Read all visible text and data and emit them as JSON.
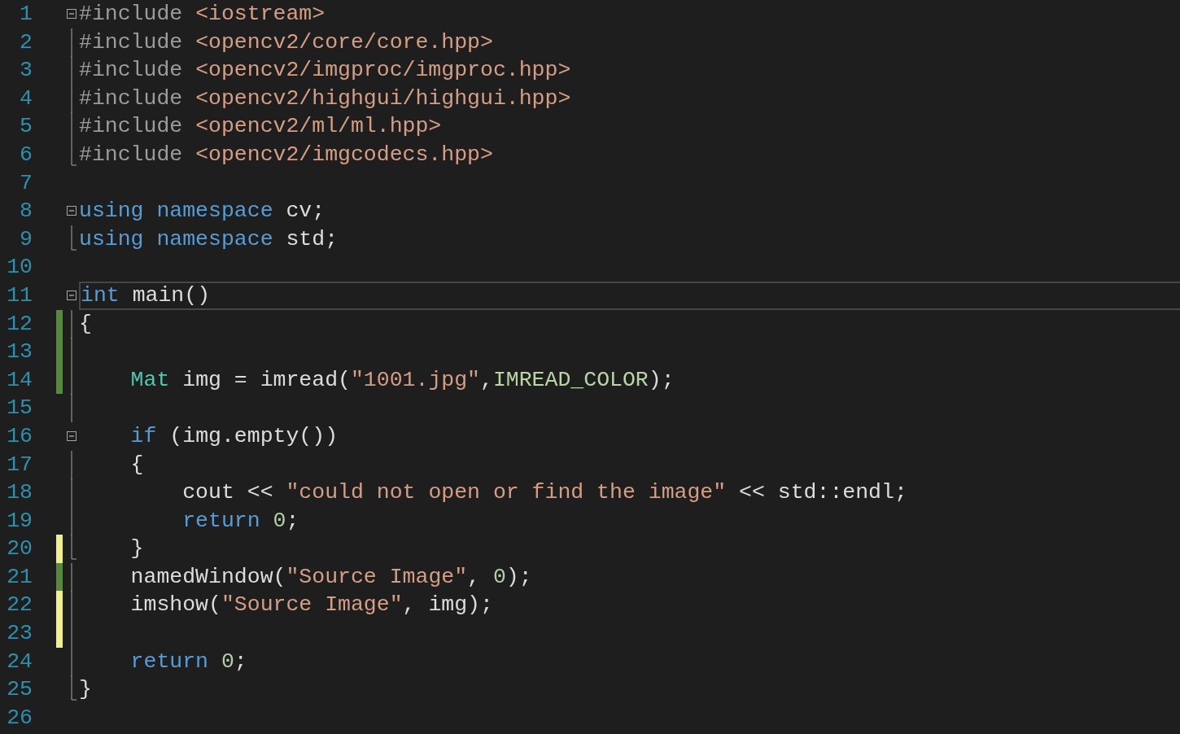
{
  "lines": [
    {
      "number": "1",
      "fold_box": true,
      "in_block": false,
      "fold_end": false,
      "changed": false,
      "current": false,
      "tokens": [
        {
          "kind": "pp",
          "t": "#include "
        },
        {
          "kind": "str",
          "t": "<iostream>"
        }
      ]
    },
    {
      "number": "2",
      "fold_box": false,
      "in_block": true,
      "fold_end": false,
      "changed": false,
      "current": false,
      "tokens": [
        {
          "kind": "pp",
          "t": "#include "
        },
        {
          "kind": "str",
          "t": "<opencv2/core/core.hpp>"
        }
      ]
    },
    {
      "number": "3",
      "fold_box": false,
      "in_block": true,
      "fold_end": false,
      "changed": false,
      "current": false,
      "tokens": [
        {
          "kind": "pp",
          "t": "#include "
        },
        {
          "kind": "str",
          "t": "<opencv2/imgproc/imgproc.hpp>"
        }
      ]
    },
    {
      "number": "4",
      "fold_box": false,
      "in_block": true,
      "fold_end": false,
      "changed": false,
      "current": false,
      "tokens": [
        {
          "kind": "pp",
          "t": "#include "
        },
        {
          "kind": "str",
          "t": "<opencv2/highgui/highgui.hpp>"
        }
      ]
    },
    {
      "number": "5",
      "fold_box": false,
      "in_block": true,
      "fold_end": false,
      "changed": false,
      "current": false,
      "tokens": [
        {
          "kind": "pp",
          "t": "#include "
        },
        {
          "kind": "str",
          "t": "<opencv2/ml/ml.hpp>"
        }
      ]
    },
    {
      "number": "6",
      "fold_box": false,
      "in_block": false,
      "fold_end": true,
      "changed": false,
      "current": false,
      "tokens": [
        {
          "kind": "pp",
          "t": "#include "
        },
        {
          "kind": "str",
          "t": "<opencv2/imgcodecs.hpp>"
        }
      ]
    },
    {
      "number": "7",
      "fold_box": false,
      "in_block": false,
      "fold_end": false,
      "changed": false,
      "current": false
    },
    {
      "number": "8",
      "fold_box": true,
      "in_block": false,
      "fold_end": false,
      "changed": false,
      "current": false,
      "tokens": [
        {
          "kind": "kw",
          "t": "using namespace "
        },
        {
          "kind": "plain",
          "t": "cv;"
        }
      ]
    },
    {
      "number": "9",
      "fold_box": false,
      "in_block": false,
      "fold_end": true,
      "changed": false,
      "current": false,
      "tokens": [
        {
          "kind": "kw",
          "t": "using namespace "
        },
        {
          "kind": "plain",
          "t": "std;"
        }
      ]
    },
    {
      "number": "10",
      "fold_box": false,
      "in_block": false,
      "fold_end": false,
      "changed": false,
      "current": false
    },
    {
      "number": "11",
      "fold_box": true,
      "in_block": false,
      "fold_end": false,
      "changed": false,
      "current": true,
      "tokens": [
        {
          "kind": "kw",
          "t": "int "
        },
        {
          "kind": "plain",
          "t": "main()"
        }
      ]
    },
    {
      "number": "12",
      "fold_box": false,
      "in_block": true,
      "fold_end": false,
      "changed": true,
      "saved": true,
      "current": false,
      "tokens": [
        {
          "kind": "plain",
          "t": "{"
        }
      ]
    },
    {
      "number": "13",
      "fold_box": false,
      "in_block": true,
      "fold_end": false,
      "changed": true,
      "saved": true,
      "current": false
    },
    {
      "number": "14",
      "fold_box": false,
      "in_block": true,
      "fold_end": false,
      "changed": true,
      "saved": true,
      "current": false,
      "tokens": [
        {
          "kind": "type",
          "t": "    Mat"
        },
        {
          "kind": "plain",
          "t": " img = imread("
        },
        {
          "kind": "str",
          "t": "\"1001.jpg\""
        },
        {
          "kind": "plain",
          "t": ","
        },
        {
          "kind": "macro",
          "t": "IMREAD_COLOR"
        },
        {
          "kind": "plain",
          "t": ");"
        }
      ]
    },
    {
      "number": "15",
      "fold_box": false,
      "in_block": true,
      "fold_end": false,
      "changed": false,
      "current": false
    },
    {
      "number": "16",
      "fold_box": true,
      "in_block": false,
      "fold_end": false,
      "changed": false,
      "current": false,
      "tokens": [
        {
          "kind": "kw",
          "t": "    if"
        },
        {
          "kind": "plain",
          "t": " (img.empty())"
        }
      ]
    },
    {
      "number": "17",
      "fold_box": false,
      "in_block": true,
      "fold_end": false,
      "changed": false,
      "current": false,
      "tokens": [
        {
          "kind": "plain",
          "t": "    {"
        }
      ]
    },
    {
      "number": "18",
      "fold_box": false,
      "in_block": true,
      "fold_end": false,
      "changed": false,
      "current": false,
      "tokens": [
        {
          "kind": "plain",
          "t": "        cout << "
        },
        {
          "kind": "str",
          "t": "\"could not open or find the image\""
        },
        {
          "kind": "plain",
          "t": " << std::endl;"
        }
      ]
    },
    {
      "number": "19",
      "fold_box": false,
      "in_block": true,
      "fold_end": false,
      "changed": false,
      "current": false,
      "tokens": [
        {
          "kind": "kw",
          "t": "        return "
        },
        {
          "kind": "num",
          "t": "0"
        },
        {
          "kind": "plain",
          "t": ";"
        }
      ]
    },
    {
      "number": "20",
      "fold_box": false,
      "in_block": false,
      "fold_end": true,
      "changed": true,
      "saved": false,
      "current": false,
      "tokens": [
        {
          "kind": "plain",
          "t": "    }"
        }
      ]
    },
    {
      "number": "21",
      "fold_box": false,
      "in_block": true,
      "fold_end": false,
      "changed": true,
      "saved": true,
      "current": false,
      "tokens": [
        {
          "kind": "plain",
          "t": "    namedWindow("
        },
        {
          "kind": "str",
          "t": "\"Source Image\""
        },
        {
          "kind": "plain",
          "t": ", "
        },
        {
          "kind": "num",
          "t": "0"
        },
        {
          "kind": "plain",
          "t": ");"
        }
      ]
    },
    {
      "number": "22",
      "fold_box": false,
      "in_block": true,
      "fold_end": false,
      "changed": true,
      "saved": false,
      "current": false,
      "tokens": [
        {
          "kind": "plain",
          "t": "    imshow("
        },
        {
          "kind": "str",
          "t": "\"Source Image\""
        },
        {
          "kind": "plain",
          "t": ", img);"
        }
      ]
    },
    {
      "number": "23",
      "fold_box": false,
      "in_block": true,
      "fold_end": false,
      "changed": true,
      "saved": false,
      "current": false
    },
    {
      "number": "24",
      "fold_box": false,
      "in_block": true,
      "fold_end": false,
      "changed": false,
      "current": false,
      "tokens": [
        {
          "kind": "kw",
          "t": "    return "
        },
        {
          "kind": "num",
          "t": "0"
        },
        {
          "kind": "plain",
          "t": ";"
        }
      ]
    },
    {
      "number": "25",
      "fold_box": false,
      "in_block": false,
      "fold_end": true,
      "changed": false,
      "current": false,
      "tokens": [
        {
          "kind": "plain",
          "t": "}"
        }
      ]
    },
    {
      "number": "26",
      "fold_box": false,
      "in_block": false,
      "fold_end": false,
      "changed": false,
      "current": false
    }
  ]
}
